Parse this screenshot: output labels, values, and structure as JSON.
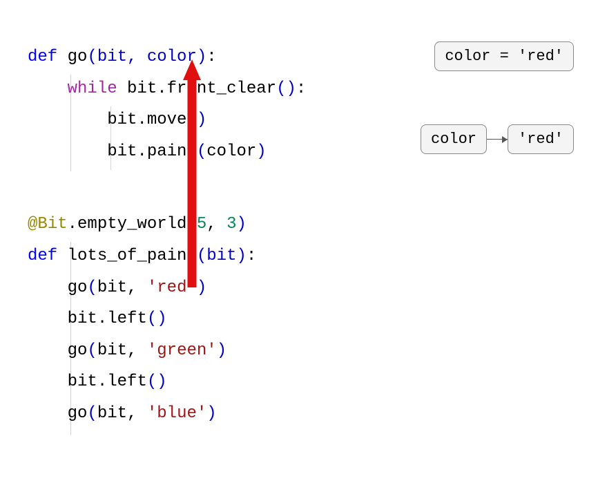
{
  "code1": {
    "line1": {
      "def": "def",
      "name": "go",
      "params": "(bit, color)",
      "colon": ":"
    },
    "line2": {
      "while": "while",
      "expr": "bit",
      "dot": ".",
      "method": "front_clear",
      "parens": "()",
      "colon": ":"
    },
    "line3": {
      "expr": "bit",
      "dot": ".",
      "method": "move",
      "parens": "()"
    },
    "line4": {
      "expr": "bit",
      "dot": ".",
      "method": "paint",
      "open": "(",
      "arg": "color",
      "close": ")"
    }
  },
  "code2": {
    "line1": {
      "at": "@Bit",
      "dot": ".",
      "name": "empty_world",
      "open": "(",
      "arg1": "5",
      "comma": ", ",
      "arg2": "3",
      "close": ")"
    },
    "line2": {
      "def": "def",
      "name": "lots_of_paint",
      "params": "(bit)",
      "colon": ":"
    },
    "line3": {
      "call": "go",
      "open": "(",
      "arg1": "bit",
      "comma": ", ",
      "str": "'red'",
      "close": ")"
    },
    "line4": {
      "expr": "bit",
      "dot": ".",
      "method": "left",
      "parens": "()"
    },
    "line5": {
      "call": "go",
      "open": "(",
      "arg1": "bit",
      "comma": ", ",
      "str": "'green'",
      "close": ")"
    },
    "line6": {
      "expr": "bit",
      "dot": ".",
      "method": "left",
      "parens": "()"
    },
    "line7": {
      "call": "go",
      "open": "(",
      "arg1": "bit",
      "comma": ", ",
      "str": "'blue'",
      "close": ")"
    }
  },
  "box1": {
    "text": "color = 'red'"
  },
  "box2": {
    "left": "color",
    "right": "'red'"
  },
  "arrow": {
    "color": "#e01010"
  }
}
